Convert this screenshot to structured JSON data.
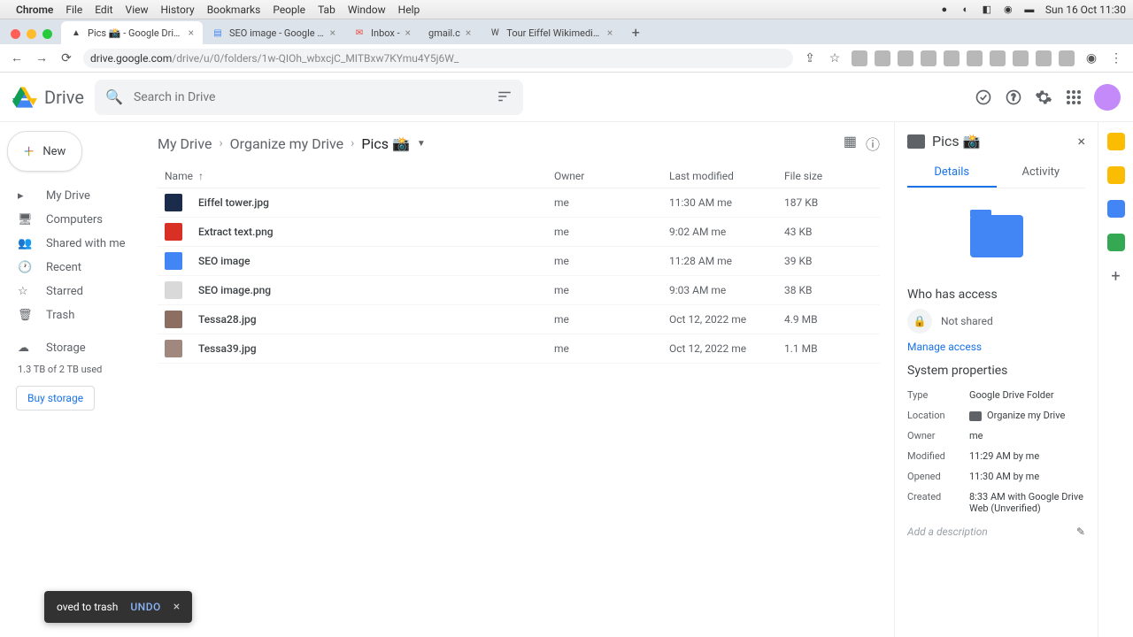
{
  "mac_menu": {
    "app": "Chrome",
    "items": [
      "File",
      "Edit",
      "View",
      "History",
      "Bookmarks",
      "People",
      "Tab",
      "Window",
      "Help"
    ],
    "clock": "Sun 16 Oct 11:30"
  },
  "tabs": [
    {
      "title": "Pics 📸 - Google Drive",
      "active": true
    },
    {
      "title": "SEO image - Google Docs",
      "active": false
    },
    {
      "title": "Inbox -",
      "active": false
    },
    {
      "title": "gmail.c",
      "active": false
    },
    {
      "title": "Tour Eiffel Wikimedia Commo",
      "active": false
    }
  ],
  "url": {
    "host": "drive.google.com",
    "path": "/drive/u/0/folders/1w-QIOh_wbxcjC_MITBxw7KYmu4Y5j6W_"
  },
  "drive": {
    "app_name": "Drive",
    "search_placeholder": "Search in Drive",
    "new_label": "New",
    "nav": [
      {
        "label": "My Drive",
        "key": "mydrive"
      },
      {
        "label": "Computers",
        "key": "computers"
      },
      {
        "label": "Shared with me",
        "key": "shared"
      },
      {
        "label": "Recent",
        "key": "recent"
      },
      {
        "label": "Starred",
        "key": "starred"
      },
      {
        "label": "Trash",
        "key": "trash"
      },
      {
        "label": "Storage",
        "key": "storage"
      }
    ],
    "storage_text": "1.3 TB of 2 TB used",
    "buy_label": "Buy storage"
  },
  "breadcrumb": [
    "My Drive",
    "Organize my Drive",
    "Pics 📸"
  ],
  "columns": {
    "name": "Name",
    "owner": "Owner",
    "modified": "Last modified",
    "size": "File size"
  },
  "files": [
    {
      "name": "Eiffel tower.jpg",
      "owner": "me",
      "modified": "11:30 AM me",
      "size": "187 KB",
      "color": "#1a2b4c"
    },
    {
      "name": "Extract text.png",
      "owner": "me",
      "modified": "9:02 AM me",
      "size": "43 KB",
      "color": "#d93025"
    },
    {
      "name": "SEO image",
      "owner": "me",
      "modified": "11:28 AM me",
      "size": "39 KB",
      "color": "#4285f4"
    },
    {
      "name": "SEO image.png",
      "owner": "me",
      "modified": "9:03 AM me",
      "size": "38 KB",
      "color": "#d9d9d9"
    },
    {
      "name": "Tessa28.jpg",
      "owner": "me",
      "modified": "Oct 12, 2022 me",
      "size": "4.9 MB",
      "color": "#8d6e63"
    },
    {
      "name": "Tessa39.jpg",
      "owner": "me",
      "modified": "Oct 12, 2022 me",
      "size": "1.1 MB",
      "color": "#a1887f"
    }
  ],
  "details": {
    "title": "Pics 📸",
    "tab_details": "Details",
    "tab_activity": "Activity",
    "access_heading": "Who has access",
    "not_shared": "Not shared",
    "manage": "Manage access",
    "sys_heading": "System properties",
    "props": {
      "type_l": "Type",
      "type_v": "Google Drive Folder",
      "location_l": "Location",
      "location_v": "Organize my Drive",
      "owner_l": "Owner",
      "owner_v": "me",
      "modified_l": "Modified",
      "modified_v": "11:29 AM by me",
      "opened_l": "Opened",
      "opened_v": "11:30 AM by me",
      "created_l": "Created",
      "created_v": "8:33 AM with Google Drive Web (Unverified)"
    },
    "desc_placeholder": "Add a description"
  },
  "toast": {
    "text": "oved to trash",
    "undo": "UNDO"
  }
}
